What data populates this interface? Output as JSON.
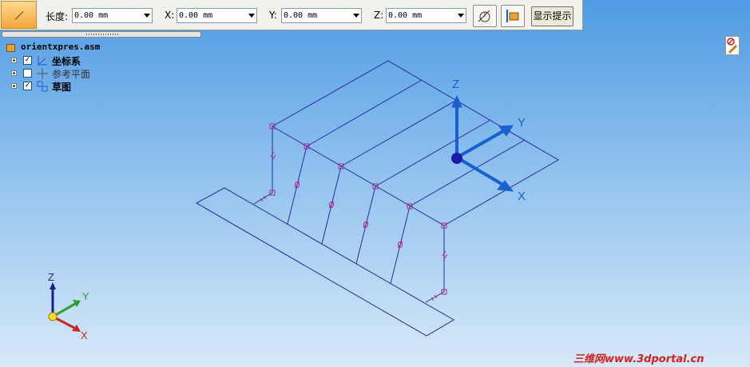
{
  "toolbar": {
    "length_label": "长度:",
    "length_value": "0.00 mm",
    "x_label": "X:",
    "x_value": "0.00 mm",
    "y_label": "Y:",
    "y_value": "0.00 mm",
    "z_label": "Z:",
    "z_value": "0.00 mm",
    "hint_button": "显示提示"
  },
  "tree": {
    "root": "orientxpres.asm",
    "items": [
      {
        "label": "坐标系",
        "checked": true
      },
      {
        "label": "参考平面",
        "checked": false
      },
      {
        "label": "草图",
        "checked": true
      }
    ]
  },
  "triad": {
    "z": "Z",
    "y": "Y",
    "x": "X"
  },
  "mini_triad": {
    "z": "Z",
    "y": "Y",
    "x": "X"
  },
  "watermark": "三维网www.3dportal.cn",
  "colors": {
    "sketch_line": "#2a2aa0",
    "constraint": "#c0208a",
    "triad": "#1660d0",
    "watermark": "#d42020"
  }
}
